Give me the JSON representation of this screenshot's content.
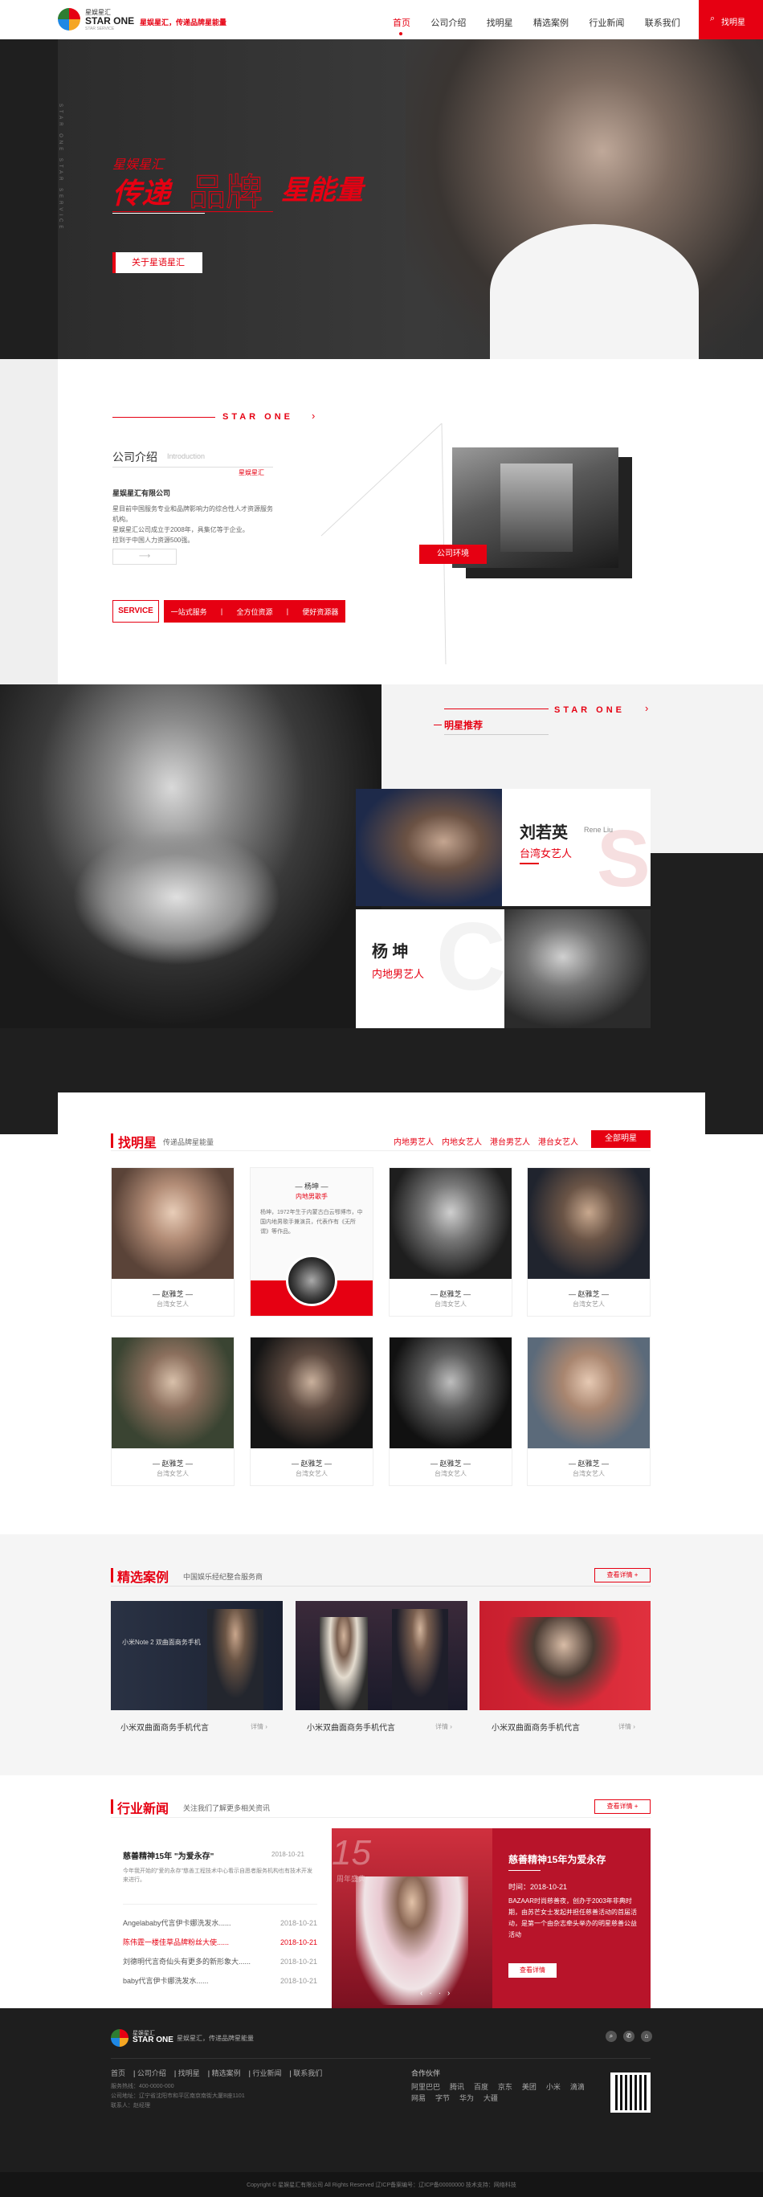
{
  "header": {
    "brand_cn": "星娱星汇",
    "brand_en": "STAR ONE",
    "brand_sub": "STAR SERVICE",
    "slogan": "星娱星汇，传递品牌星能量",
    "nav": [
      "首页",
      "公司介绍",
      "找明星",
      "精选案例",
      "行业新闻",
      "联系我们"
    ],
    "cta": "找明星"
  },
  "hero": {
    "small_title": "星娱星汇",
    "title_a": "传递",
    "title_b": "品牌",
    "title_c": "星能量",
    "button": "关于星语星汇",
    "vertical_text": "STAR ONE STAR SERVICE"
  },
  "intro": {
    "brand_label": "STAR ONE",
    "section_title": "公司介绍",
    "section_en": "Introduction",
    "sub_label": "星娱星汇",
    "company": "星娱星汇有限公司",
    "lines": [
      "星目前中国服务专业和品牌影响力的综合性人才资源服务",
      "机构。",
      "星娱星汇公司成立于2008年，具集亿等于企业。",
      "拉到于中国人力资源500强。"
    ],
    "env_label": "公司环境",
    "service": "SERVICE",
    "tags": [
      "一站式服务",
      "全方位资源",
      "便好资源器"
    ]
  },
  "stars": {
    "brand_label": "STAR ONE",
    "heading": "明星推荐",
    "p1_name": "刘若英",
    "p1_en": "Rene Liu",
    "p1_role": "台湾女艺人",
    "p2_name": "杨 坤",
    "p2_role": "内地男艺人",
    "big_s": "S"
  },
  "find": {
    "title": "找明星",
    "subtitle": "传递品牌星能量",
    "tabs": [
      "内地男艺人",
      "内地女艺人",
      "港台男艺人",
      "港台女艺人"
    ],
    "all": "全部明星",
    "featured_name": "— 杨坤 —",
    "featured_role": "内地男歌手",
    "featured_desc": "杨坤，1972年生于内蒙古白云鄂博市，中国内地男歌手兼演员，代表作有《无所谓》等作品。",
    "cards": [
      {
        "name": "— 赵雅芝 —",
        "role": "台湾女艺人"
      },
      {
        "name": "— 赵雅芝 —",
        "role": "台湾女艺人"
      },
      {
        "name": "— 赵雅芝 —",
        "role": "台湾女艺人"
      },
      {
        "name": "— 赵雅芝 —",
        "role": "台湾女艺人"
      },
      {
        "name": "— 赵雅芝 —",
        "role": "台湾女艺人"
      },
      {
        "name": "— 赵雅芝 —",
        "role": "台湾女艺人"
      },
      {
        "name": "— 赵雅芝 —",
        "role": "台湾女艺人"
      }
    ]
  },
  "cases": {
    "title": "精选案例",
    "subtitle": "中国娱乐经纪整合服务商",
    "more": "查看详情 +",
    "items": [
      {
        "caption": "小米双曲面商务手机代言",
        "more": "详情 ›"
      },
      {
        "caption": "小米双曲面商务手机代言",
        "more": "详情 ›"
      },
      {
        "caption": "小米双曲面商务手机代言",
        "more": "详情 ›"
      }
    ],
    "ad_text": "小米Note 2 双曲面商务手机"
  },
  "news": {
    "title": "行业新闻",
    "subtitle": "关注我们了解更多相关资讯",
    "more": "查看详情 +",
    "lead_title": "慈善精神15年 \"为爱永存\"",
    "lead_date": "2018-10-21",
    "lead_desc": "今年我开始的\"爱的永存\"慈善工程技术中心看示自愿者服务机构也有技术开发来进行。",
    "rows": [
      {
        "title": "Angelababy代言伊卡娜洗发水......",
        "date": "2018-10-21"
      },
      {
        "title": "陈伟霆一楼佳草品牌粉丝大使......",
        "date": "2018-10-21"
      },
      {
        "title": "刘德明代言奇仙头有更多的新形象大......",
        "date": "2018-10-21"
      },
      {
        "title": "baby代言伊卡娜洗发水......",
        "date": "2018-10-21"
      }
    ],
    "feature_title": "慈善精神15年为爱永存",
    "feature_time": "时间：2018-10-21",
    "feature_desc": "BAZAAR时尚慈善夜，创办于2003年非典时期，由苏芒女士发起并担任慈善活动的首届活动，是第一个由杂志牵头举办的明星慈善公益活动",
    "feature_btn": "查看详情",
    "anniv": "15",
    "anniv_text": "周年盛典"
  },
  "footer": {
    "brand_cn": "星娱星汇",
    "brand_en": "STAR ONE",
    "slogan": "星娱星汇，传递品牌星能量",
    "links": [
      "首页",
      "公司介绍",
      "找明星",
      "精选案例",
      "行业新闻",
      "联系我们"
    ],
    "info": [
      "服务热线：400-0000-000",
      "公司地址：辽宁省沈阳市和平区南京南街大厦B座1101",
      "联系人：赵经理"
    ],
    "partners_title": "合作伙伴",
    "partners": [
      "阿里巴巴",
      "腾讯",
      "百度",
      "京东",
      "美团",
      "小米",
      "滴滴",
      "网易",
      "字节",
      "华为",
      "大疆"
    ],
    "copyright": "Copyright © 星娱星汇有限公司  All Rights Reserved  辽ICP备案编号：辽ICP备00000000  技术支持：网络科技"
  },
  "colors": {
    "accent": "#e60012",
    "dark": "#1f1f1f"
  }
}
